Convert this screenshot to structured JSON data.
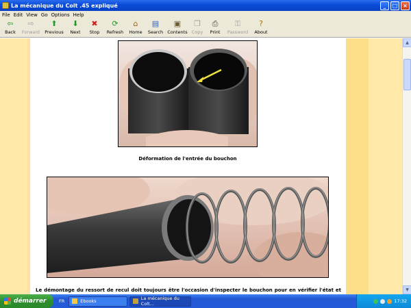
{
  "window": {
    "title": "La mécanique du Colt .45 expliqué"
  },
  "menu": [
    "File",
    "Edit",
    "View",
    "Go",
    "Options",
    "Help"
  ],
  "toolbar": [
    {
      "label": "Back",
      "icon": "back-arrow-icon",
      "enabled": true,
      "glyph": "⇦",
      "color": "#1e9a2a"
    },
    {
      "label": "Forward",
      "icon": "forward-arrow-icon",
      "enabled": false,
      "glyph": "⇨",
      "color": "#a0a0a0"
    },
    {
      "label": "Previous",
      "icon": "up-arrow-icon",
      "enabled": true,
      "glyph": "⬆",
      "color": "#1e9a2a"
    },
    {
      "label": "Next",
      "icon": "down-arrow-icon",
      "enabled": true,
      "glyph": "⬇",
      "color": "#1e9a2a"
    },
    {
      "label": "Stop",
      "icon": "stop-icon",
      "enabled": true,
      "glyph": "✖",
      "color": "#d02020"
    },
    {
      "label": "Refresh",
      "icon": "refresh-icon",
      "enabled": true,
      "glyph": "⟳",
      "color": "#1e9a2a"
    },
    {
      "label": "Home",
      "icon": "home-icon",
      "enabled": true,
      "glyph": "⌂",
      "color": "#a06010"
    },
    {
      "label": "Search",
      "icon": "search-icon",
      "enabled": true,
      "glyph": "▤",
      "color": "#3060c0"
    },
    {
      "label": "Contents",
      "icon": "contents-icon",
      "enabled": true,
      "glyph": "▣",
      "color": "#6a5a30"
    },
    {
      "label": "Copy",
      "icon": "copy-icon",
      "enabled": false,
      "glyph": "❐",
      "color": "#a0a0a0"
    },
    {
      "label": "Print",
      "icon": "print-icon",
      "enabled": true,
      "glyph": "⎙",
      "color": "#404040"
    },
    {
      "label": "Password",
      "icon": "key-icon",
      "enabled": false,
      "glyph": "⚿",
      "color": "#a0a0a0"
    },
    {
      "label": "About",
      "icon": "about-icon",
      "enabled": true,
      "glyph": "?",
      "color": "#a07010"
    }
  ],
  "content": {
    "caption": "Déformation de l'entrée du bouchon",
    "paragraph": "Le démontage du ressort de recul doit toujours être l'occasion d'inspecter le bouchon pour en vérifier l'état et voir si"
  },
  "taskbar": {
    "start_label": "démarrer",
    "language": "FR",
    "tasks": [
      {
        "label": "Ebooks",
        "active": false
      },
      {
        "label": "La mécanique du Colt...",
        "active": true
      }
    ],
    "clock": "17:32"
  },
  "colors": {
    "accent": "#0a4bd6",
    "page_margin": "#ffe8a8",
    "arrow": "#f0e040"
  }
}
